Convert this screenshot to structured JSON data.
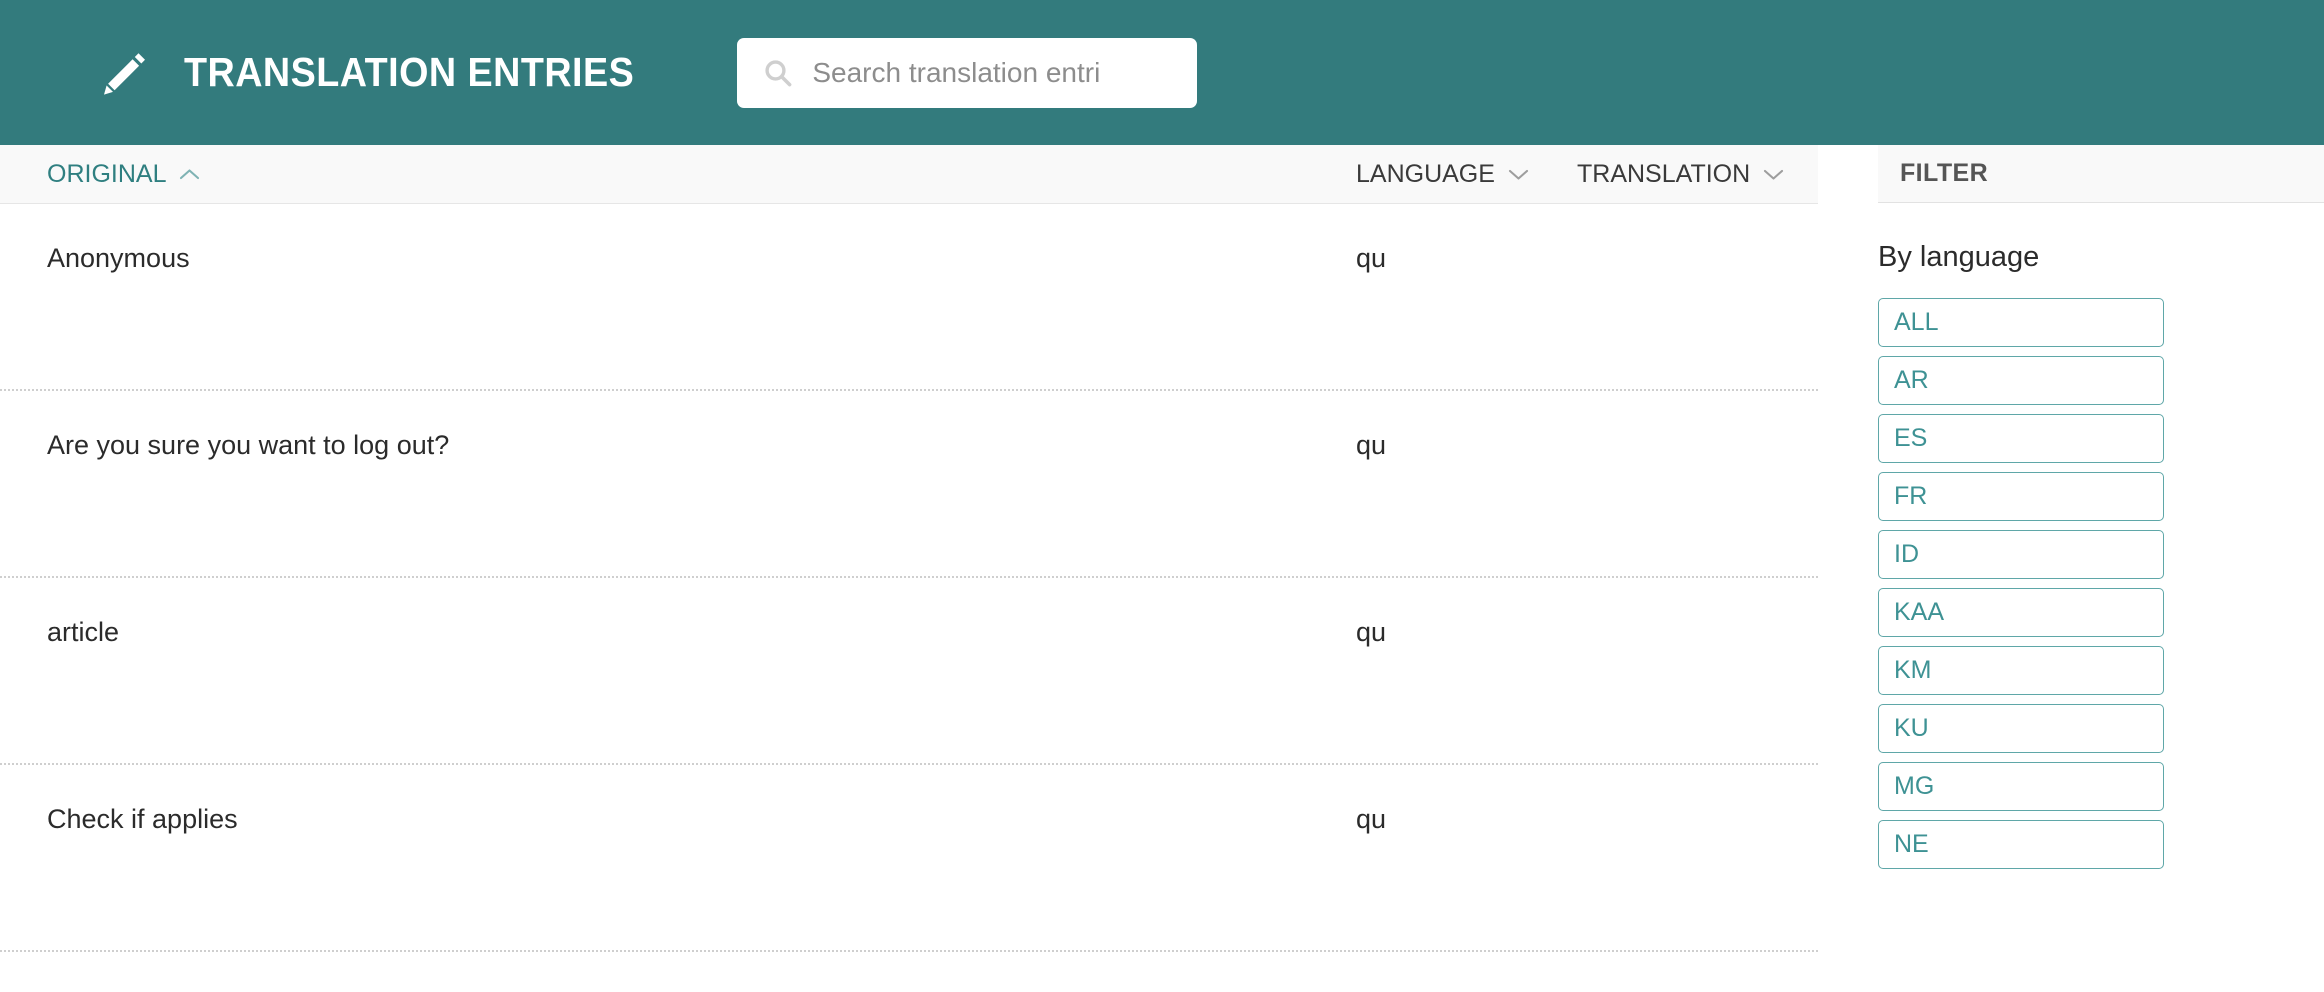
{
  "header": {
    "icon": "pencil-icon",
    "title": "TRANSLATION ENTRIES",
    "search": {
      "icon": "search-icon",
      "value": "",
      "placeholder": "Search translation entri"
    },
    "background_color": "#337b7d"
  },
  "table": {
    "columns": [
      {
        "label": "ORIGINAL",
        "sort_icon": "chevron-up-icon",
        "active": true,
        "color": "#2f7f80"
      },
      {
        "label": "LANGUAGE",
        "sort_icon": "chevron-down-icon",
        "active": false,
        "color": "#3a3a3a"
      },
      {
        "label": "TRANSLATION",
        "sort_icon": "chevron-down-icon",
        "active": false,
        "color": "#3a3a3a"
      }
    ],
    "rows": [
      {
        "original": "Anonymous",
        "language": "qu",
        "translation": ""
      },
      {
        "original": "Are you sure you want to log out?",
        "language": "qu",
        "translation": ""
      },
      {
        "original": "article",
        "language": "qu",
        "translation": ""
      },
      {
        "original": "Check if applies",
        "language": "qu",
        "translation": ""
      }
    ]
  },
  "filter": {
    "heading": "FILTER",
    "subtitle": "By language",
    "options": [
      {
        "label": "ALL"
      },
      {
        "label": "AR"
      },
      {
        "label": "ES"
      },
      {
        "label": "FR"
      },
      {
        "label": "ID"
      },
      {
        "label": "KAA"
      },
      {
        "label": "KM"
      },
      {
        "label": "KU"
      },
      {
        "label": "MG"
      },
      {
        "label": "NE"
      }
    ],
    "accent_color": "#3e9294"
  }
}
